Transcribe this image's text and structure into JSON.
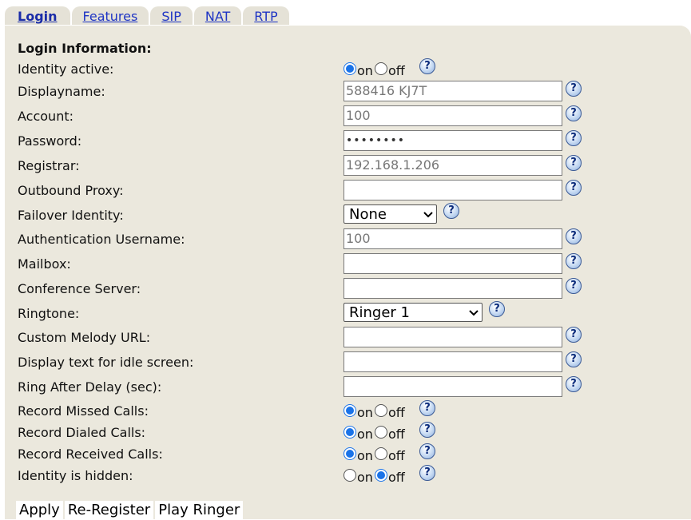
{
  "tabs": [
    {
      "label": "Login",
      "active": true
    },
    {
      "label": "Features",
      "active": false
    },
    {
      "label": "SIP",
      "active": false
    },
    {
      "label": "NAT",
      "active": false
    },
    {
      "label": "RTP",
      "active": false
    }
  ],
  "section_title": "Login Information:",
  "help_glyph": "?",
  "radio": {
    "on": "on",
    "off": "off"
  },
  "fields": {
    "identity_active": {
      "label": "Identity active:",
      "value": "on"
    },
    "displayname": {
      "label": "Displayname:",
      "value": "588416 KJ7T"
    },
    "account": {
      "label": "Account:",
      "value": "100"
    },
    "password": {
      "label": "Password:",
      "value": "••••••••"
    },
    "registrar": {
      "label": "Registrar:",
      "value": "192.168.1.206"
    },
    "outbound_proxy": {
      "label": "Outbound Proxy:",
      "value": ""
    },
    "failover_identity": {
      "label": "Failover Identity:",
      "value": "None"
    },
    "auth_username": {
      "label": "Authentication Username:",
      "value": "100"
    },
    "mailbox": {
      "label": "Mailbox:",
      "value": ""
    },
    "conference_server": {
      "label": "Conference Server:",
      "value": ""
    },
    "ringtone": {
      "label": "Ringtone:",
      "value": "Ringer 1"
    },
    "custom_melody_url": {
      "label": "Custom Melody URL:",
      "value": ""
    },
    "idle_text": {
      "label": "Display text for idle screen:",
      "value": ""
    },
    "ring_after_delay": {
      "label": "Ring After Delay (sec):",
      "value": ""
    },
    "record_missed": {
      "label": "Record Missed Calls:",
      "value": "on"
    },
    "record_dialed": {
      "label": "Record Dialed Calls:",
      "value": "on"
    },
    "record_received": {
      "label": "Record Received Calls:",
      "value": "on"
    },
    "identity_hidden": {
      "label": "Identity is hidden:",
      "value": "off"
    }
  },
  "buttons": {
    "apply": "Apply",
    "reregister": "Re-Register",
    "play_ringer": "Play Ringer"
  },
  "colors": {
    "panel_bg": "#ebe8dd",
    "link": "#1f35c4",
    "radio_checked": "#1a73e8"
  }
}
